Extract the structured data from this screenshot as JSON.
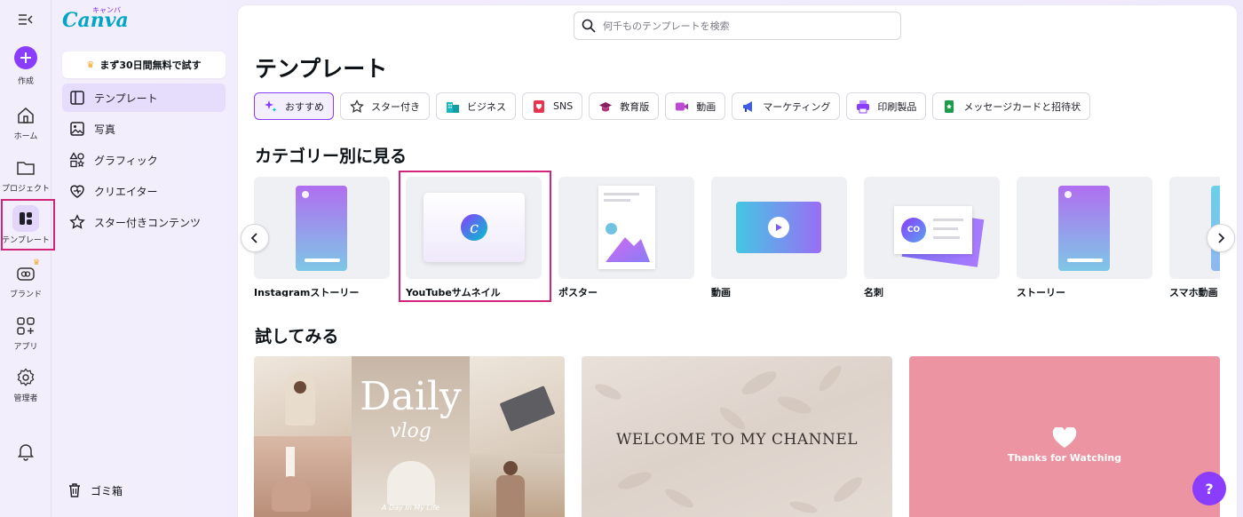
{
  "rail": {
    "create_label": "作成",
    "home_label": "ホーム",
    "projects_label": "プロジェクト",
    "templates_label": "テンプレート",
    "brand_label": "ブランド",
    "apps_label": "アプリ",
    "admin_label": "管理者"
  },
  "panel": {
    "logo_text": "Canva",
    "logo_kana": "キャンバ",
    "trial_label": "まず30日間無料で試す",
    "nav": [
      {
        "label": "テンプレート"
      },
      {
        "label": "写真"
      },
      {
        "label": "グラフィック"
      },
      {
        "label": "クリエイター"
      },
      {
        "label": "スター付きコンテンツ"
      }
    ],
    "trash_label": "ゴミ箱"
  },
  "search": {
    "placeholder": "何千ものテンプレートを検索"
  },
  "main": {
    "title": "テンプレート",
    "chips": [
      {
        "label": "おすすめ",
        "color": "#8b3dff"
      },
      {
        "label": "スター付き",
        "color": "#333333"
      },
      {
        "label": "ビジネス",
        "color": "#19b9c1"
      },
      {
        "label": "SNS",
        "color": "#e8344e"
      },
      {
        "label": "教育版",
        "color": "#8a1f5f"
      },
      {
        "label": "動画",
        "color": "#c04ad6"
      },
      {
        "label": "マーケティング",
        "color": "#3f5ee8"
      },
      {
        "label": "印刷製品",
        "color": "#8b3dff"
      },
      {
        "label": "メッセージカードと招待状",
        "color": "#1c9b4a"
      }
    ],
    "categories_heading": "カテゴリー別に見る",
    "categories": [
      {
        "label": "Instagramストーリー"
      },
      {
        "label": "YouTubeサムネイル"
      },
      {
        "label": "ポスター"
      },
      {
        "label": "動画"
      },
      {
        "label": "名刺"
      },
      {
        "label": "ストーリー"
      },
      {
        "label": "スマホ動画"
      }
    ],
    "try_heading": "試してみる",
    "cards": [
      {
        "title": "Daily",
        "subtitle": "vlog",
        "caption": "A Day In My Life"
      },
      {
        "title": "WELCOME TO MY CHANNEL"
      },
      {
        "title": "Thanks for Watching"
      }
    ]
  },
  "help_label": "?",
  "colors": {
    "brand": "#8b3dff",
    "highlight": "#d4237a"
  }
}
